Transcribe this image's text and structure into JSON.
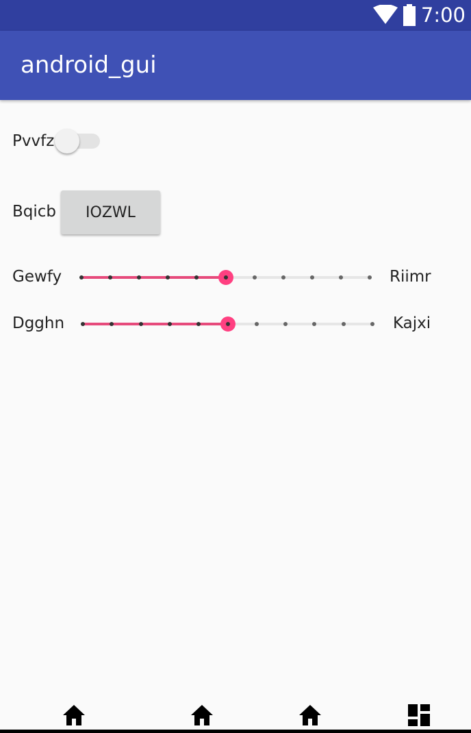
{
  "status_bar": {
    "time": "7:00",
    "icons": [
      "wifi-icon",
      "battery-icon"
    ]
  },
  "app_bar": {
    "title": "android_gui",
    "color": "#3f51b5"
  },
  "switch_row": {
    "label": "Pvvfz",
    "checked": false
  },
  "button_row": {
    "label": "Bqicb",
    "button_text": "IOZWL"
  },
  "sliders": [
    {
      "left_label": "Gewfy",
      "right_label": "Riimr",
      "min": 0,
      "max": 10,
      "value": 5
    },
    {
      "left_label": "Dgghn",
      "right_label": "Kajxi",
      "min": 0,
      "max": 10,
      "value": 5
    }
  ],
  "accent_color": "#ff4081",
  "bottom_nav": {
    "items": [
      "home-icon",
      "home-icon",
      "home-icon",
      "dashboard-icon"
    ]
  }
}
